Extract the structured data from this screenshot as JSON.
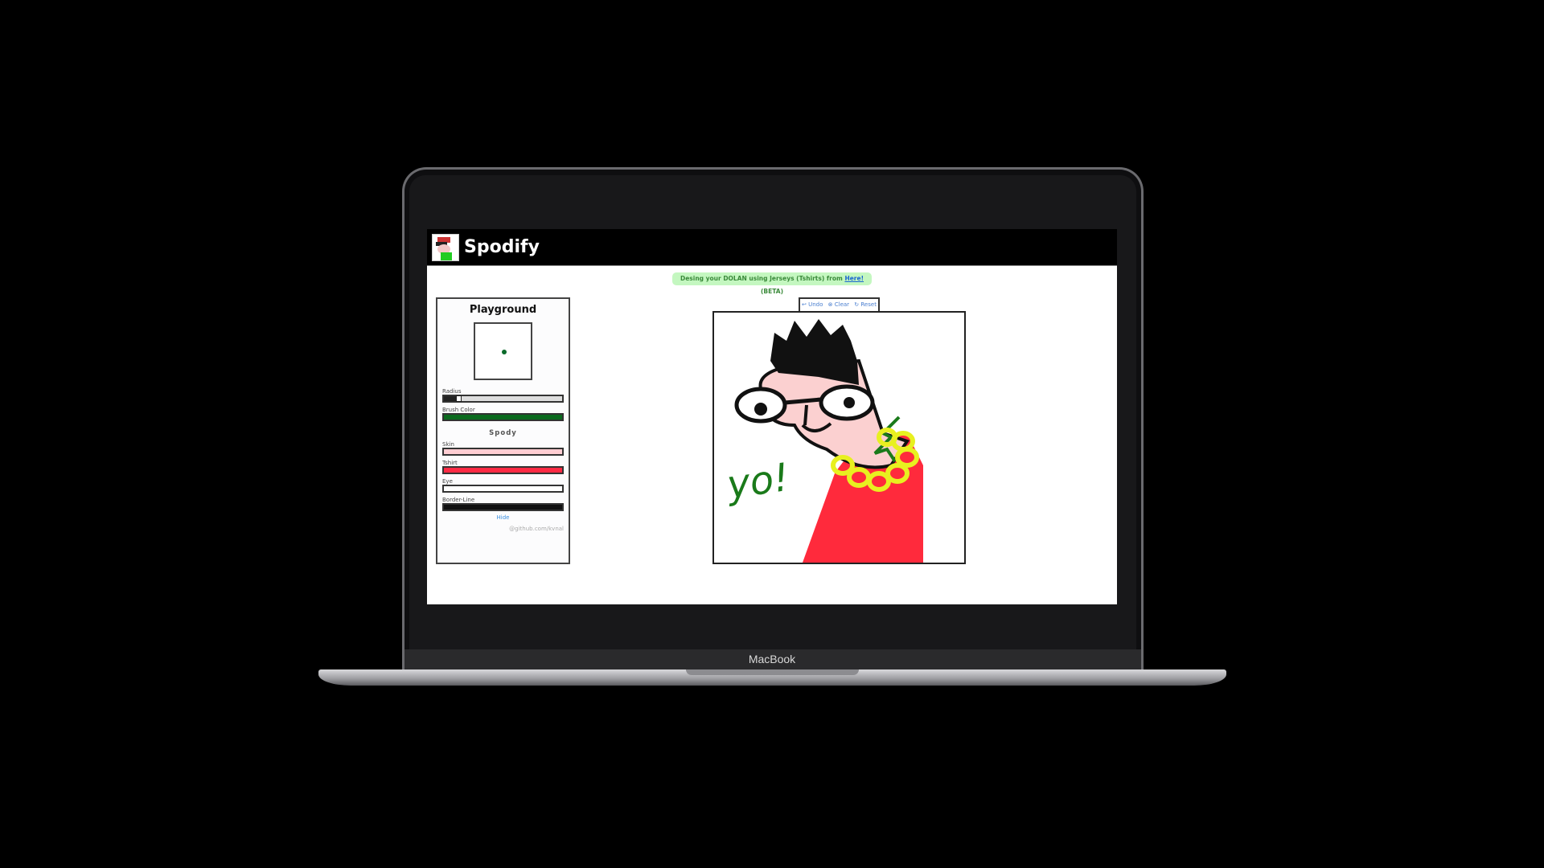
{
  "app": {
    "title": "Spodify"
  },
  "banner": {
    "text_before": "Desing your DOLAN using Jerseys (Tshirts) from ",
    "link": "Here!",
    "text_after": " (BETA)"
  },
  "toolbar": {
    "undo": "↩ Undo",
    "clear": "⊗ Clear",
    "reset": "↻ Reset"
  },
  "panel": {
    "title": "Playground",
    "radius_label": "Radius",
    "radius_value": 0.1,
    "brush_label": "Brush Color",
    "brush_color": "#0b6a1e",
    "section": "Spody",
    "colors": [
      {
        "label": "Skin",
        "color": "#ffcdd2"
      },
      {
        "label": "Tshirt",
        "color": "#ff2a44"
      },
      {
        "label": "Eye",
        "color": "#ffffff"
      },
      {
        "label": "Border-Line",
        "color": "#111111"
      }
    ],
    "hide": "Hide",
    "credit": "@github.com/kvnal"
  },
  "device": {
    "label": "MacBook"
  }
}
